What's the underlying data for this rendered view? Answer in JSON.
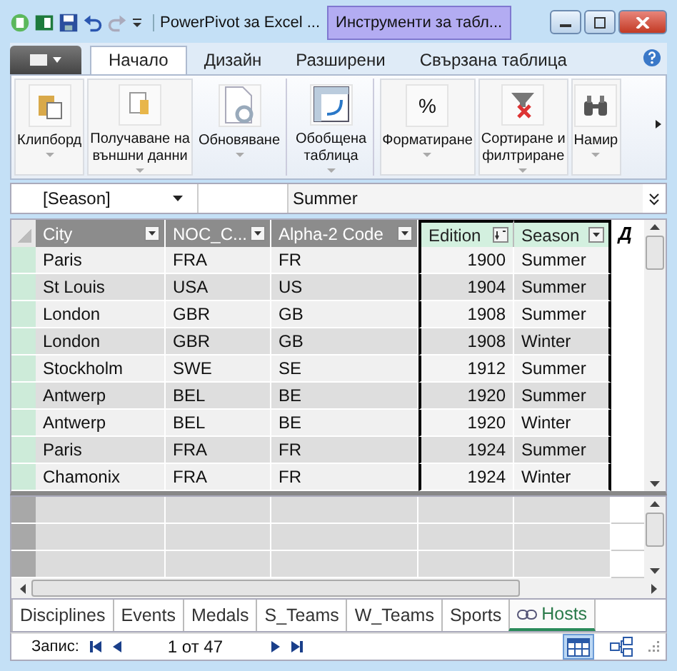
{
  "window": {
    "title": "PowerPivot за Excel ...",
    "contextual_tab": "Инструменти за табл..."
  },
  "ribbon_tabs": [
    {
      "label": "Начало",
      "selected": true
    },
    {
      "label": "Дизайн",
      "selected": false
    },
    {
      "label": "Разширени",
      "selected": false
    },
    {
      "label": "Свързана таблица",
      "selected": false
    }
  ],
  "ribbon_groups": [
    {
      "label": "Клипборд"
    },
    {
      "label": "Получаване на\nвъншни данни"
    },
    {
      "label": "Обновяване"
    },
    {
      "label": "Обобщена\nтаблица"
    },
    {
      "label": "Форматиране",
      "icon_text": "%"
    },
    {
      "label": "Сортиране и\nфилтриране"
    },
    {
      "label": "Намир"
    }
  ],
  "formula_bar": {
    "column": "[Season]",
    "value": "Summer"
  },
  "table": {
    "columns": [
      {
        "label": "City",
        "selected": false,
        "kind": "text"
      },
      {
        "label": "NOC_C...",
        "selected": false,
        "kind": "text"
      },
      {
        "label": "Alpha-2 Code",
        "selected": false,
        "kind": "text"
      },
      {
        "label": "Edition",
        "selected": true,
        "kind": "number"
      },
      {
        "label": "Season",
        "selected": true,
        "kind": "text"
      }
    ],
    "add_column": "Д",
    "rows": [
      [
        "Paris",
        "FRA",
        "FR",
        "1900",
        "Summer"
      ],
      [
        "St Louis",
        "USA",
        "US",
        "1904",
        "Summer"
      ],
      [
        "London",
        "GBR",
        "GB",
        "1908",
        "Summer"
      ],
      [
        "London",
        "GBR",
        "GB",
        "1908",
        "Winter"
      ],
      [
        "Stockholm",
        "SWE",
        "SE",
        "1912",
        "Summer"
      ],
      [
        "Antwerp",
        "BEL",
        "BE",
        "1920",
        "Summer"
      ],
      [
        "Antwerp",
        "BEL",
        "BE",
        "1920",
        "Winter"
      ],
      [
        "Paris",
        "FRA",
        "FR",
        "1924",
        "Summer"
      ],
      [
        "Chamonix",
        "FRA",
        "FR",
        "1924",
        "Winter"
      ]
    ]
  },
  "sheet_tabs": [
    {
      "label": "Disciplines",
      "selected": false,
      "linked": false
    },
    {
      "label": "Events",
      "selected": false,
      "linked": false
    },
    {
      "label": "Medals",
      "selected": false,
      "linked": false
    },
    {
      "label": "S_Teams",
      "selected": false,
      "linked": false
    },
    {
      "label": "W_Teams",
      "selected": false,
      "linked": false
    },
    {
      "label": "Sports",
      "selected": false,
      "linked": false
    },
    {
      "label": "Hosts",
      "selected": true,
      "linked": true
    }
  ],
  "status_bar": {
    "record_label": "Запис:",
    "position": "1 от 47",
    "views": [
      {
        "selected": true
      },
      {
        "selected": false
      }
    ]
  }
}
